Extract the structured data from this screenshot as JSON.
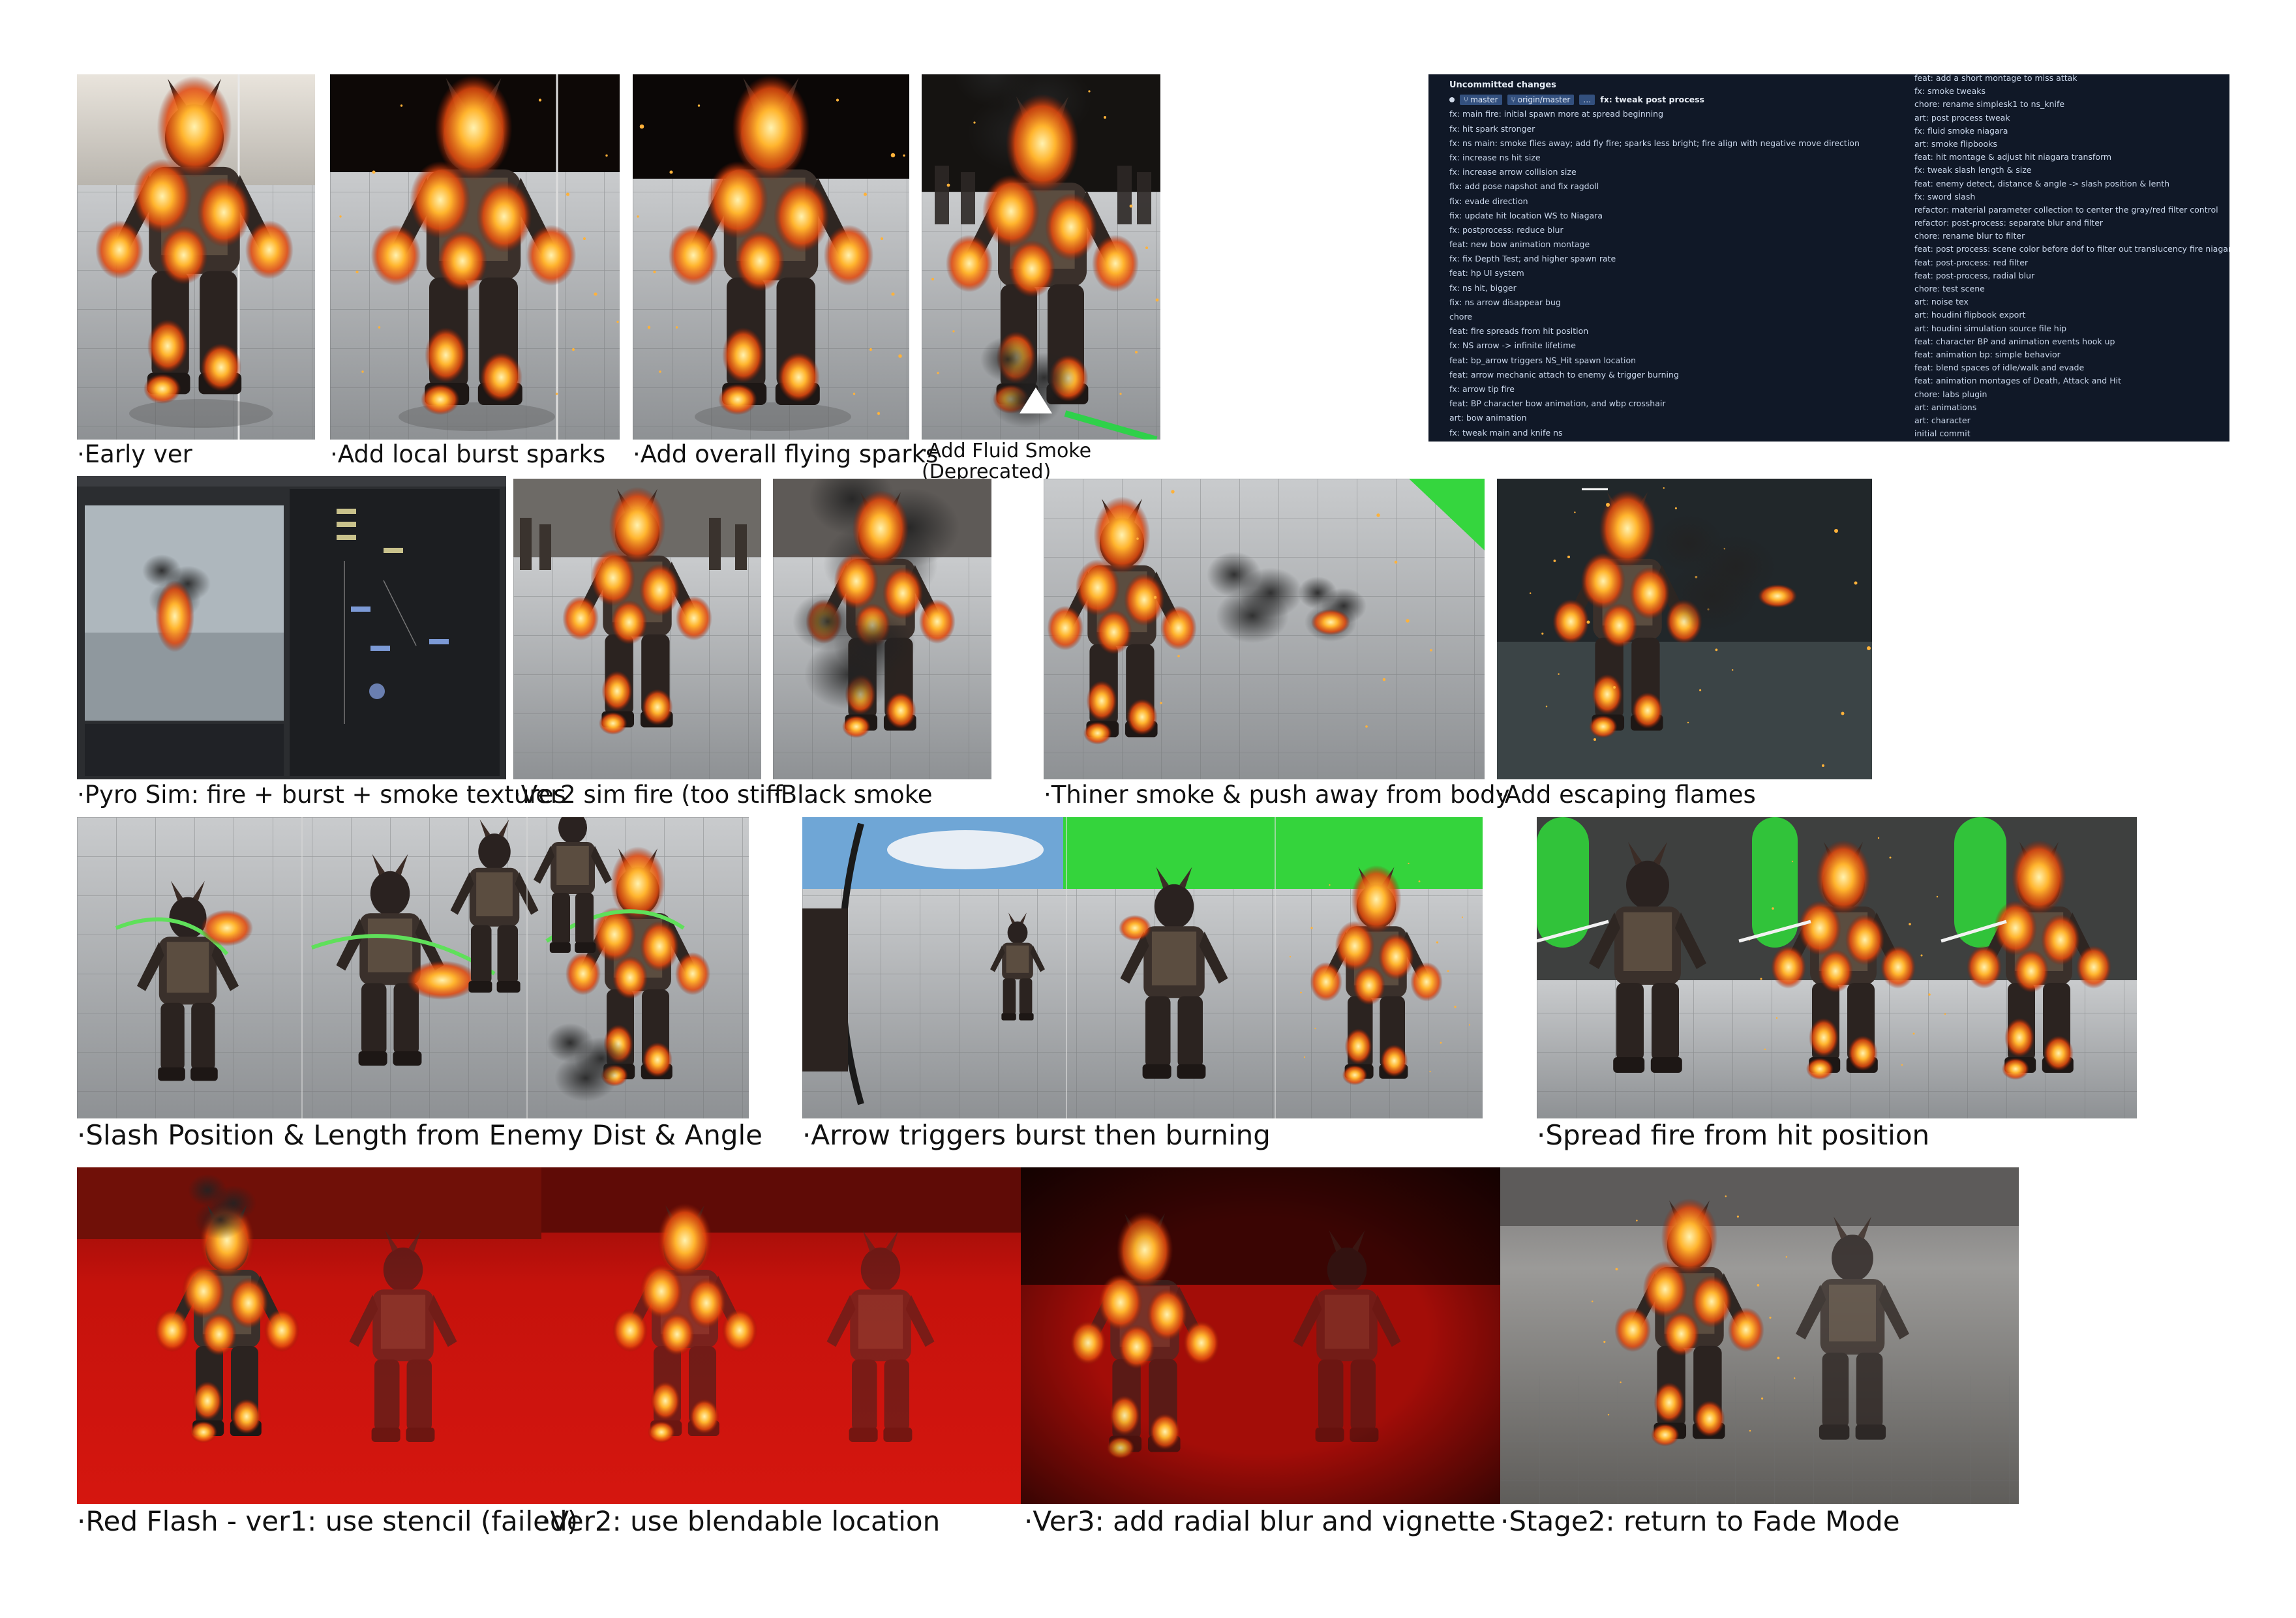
{
  "row1": {
    "captions": [
      "·Early ver",
      "·Add local burst sparks",
      "·Add overall flying sparks",
      "·Add Fluid Smoke (Deprecated)"
    ]
  },
  "git_log": {
    "uncommitted": "Uncommitted changes",
    "branches": [
      "master",
      "origin/master"
    ],
    "head_commit": "fx: tweak post process",
    "left_commits": [
      "fx: main fire: initial spawn more at spread beginning",
      "fx: hit spark stronger",
      "fx: ns main: smoke flies away; add fly fire; sparks less bright; fire align with negative move direction",
      "fx: increase ns hit size",
      "fx: increase arrow collision size",
      "fix: add pose napshot and fix ragdoll",
      "fix: evade direction",
      "fix: update hit location WS to Niagara",
      "fx: postprocess: reduce blur",
      "feat: new bow animation montage",
      "fx: fix Depth Test; and higher spawn rate",
      "feat: hp UI system",
      "fx: ns hit, bigger",
      "fix: ns arrow disappear bug",
      "chore",
      "feat: fire spreads from hit position",
      "fx: NS arrow -> infinite lifetime",
      "feat: bp_arrow triggers NS_Hit spawn location",
      "feat: arrow mechanic attach to enemy & trigger burning",
      "fx: arrow tip fire",
      "feat: BP character bow animation, and wbp crosshair",
      "art: bow animation",
      "fx: tweak main and knife ns"
    ],
    "right_commits": [
      "feat: add a short montage to miss attak",
      "fx: smoke tweaks",
      "chore: rename simplesk1 to ns_knife",
      "art: post process tweak",
      "fx: fluid smoke niagara",
      "art: smoke flipbooks",
      "feat: hit montage & adjust hit niagara transform",
      "fx: tweak slash length & size",
      "feat: enemy detect, distance & angle -> slash position & lenth",
      "fx: sword slash",
      "refactor: material parameter collection to center the gray/red filter control",
      "refactor: post-process: separate blur and filter",
      "chore: rename blur to filter",
      "feat: post process: scene color before dof to filter out translucency fire niagara",
      "feat: post-process: red filter",
      "feat: post-process, radial blur",
      "chore: test scene",
      "art: noise tex",
      "art: houdini flipbook export",
      "art: houdini simulation source file hip",
      "feat: character BP and animation events hook up",
      "feat: animation bp: simple behavior",
      "feat: blend spaces of idle/walk and evade",
      "feat: animation montages of Death, Attack and Hit",
      "chore: labs plugin",
      "art: animations",
      "art: character",
      "initial commit"
    ]
  },
  "row2": {
    "captions": [
      "·Pyro Sim: fire + burst + smoke textures",
      "·Ver2 sim fire (too stiff",
      "·Black smoke",
      "·Thiner smoke & push away from body",
      "·Add escaping flames"
    ]
  },
  "row3": {
    "captions": [
      "·Slash Position & Length from Enemy Dist & Angle",
      "·Arrow triggers burst then burning",
      "·Spread fire from hit position"
    ]
  },
  "row4": {
    "captions": [
      "·Red Flash - ver1: use stencil (failed)",
      "·Ver2: use blendable location",
      "·Ver3: add radial blur and vignette",
      "·Stage2: return to Fade Mode"
    ]
  },
  "colors": {
    "fire": "#ff8a1a",
    "fire_core": "#ffe08a",
    "red_flash": "#c40d0a",
    "git_bg": "#101827",
    "slash_green": "#55e055"
  }
}
